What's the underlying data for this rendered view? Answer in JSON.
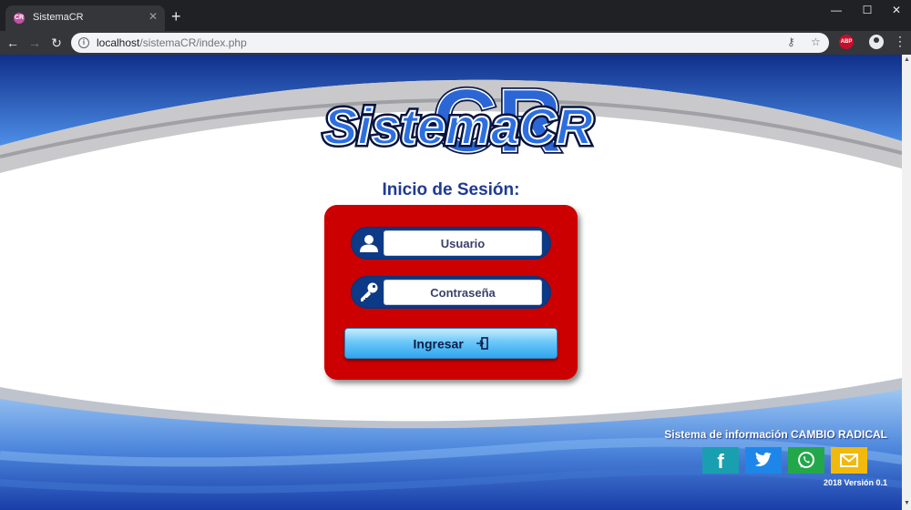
{
  "browser": {
    "tab_title": "SistemaCR",
    "tab_close": "✕",
    "new_tab": "+",
    "window_controls": {
      "minimize": "—",
      "maximize": "☐",
      "close": "✕"
    },
    "url_host": "localhost",
    "url_path": "/sistemaCR/index.php",
    "abp_label": "ABP"
  },
  "logo": {
    "text": "SistemaCR",
    "monogram": "CR"
  },
  "login": {
    "title": "Inicio de Sesión:",
    "username_placeholder": "Usuario",
    "password_placeholder": "Contraseña",
    "submit_label": "Ingresar"
  },
  "footer": {
    "title": "Sistema de información CAMBIO RADICAL",
    "version": "2018 Versión 0.1",
    "social": [
      {
        "name": "facebook",
        "glyph": "f",
        "color": "#1a9fb0"
      },
      {
        "name": "twitter",
        "color": "#1e86e8"
      },
      {
        "name": "whatsapp",
        "color": "#22a84a"
      },
      {
        "name": "email",
        "color": "#f2b90d"
      }
    ]
  },
  "colors": {
    "login_box": "#cc0000",
    "field_frame": "#0d3a86",
    "button": "#4db8f5",
    "title_text": "#1f3a93",
    "page_blue": "#1d3fa0"
  }
}
